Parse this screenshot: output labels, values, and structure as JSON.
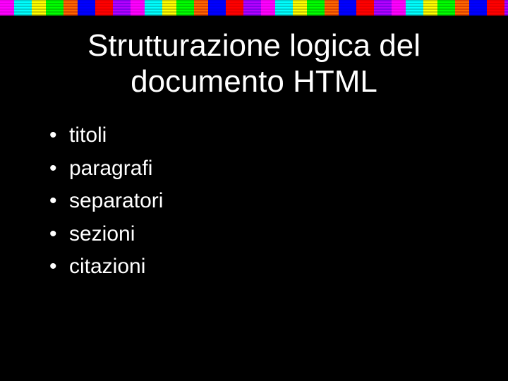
{
  "slide": {
    "title": "Strutturazione logica del documento HTML",
    "bullets": [
      "titoli",
      "paragrafi",
      "separatori",
      "sezioni",
      "citazioni"
    ]
  }
}
